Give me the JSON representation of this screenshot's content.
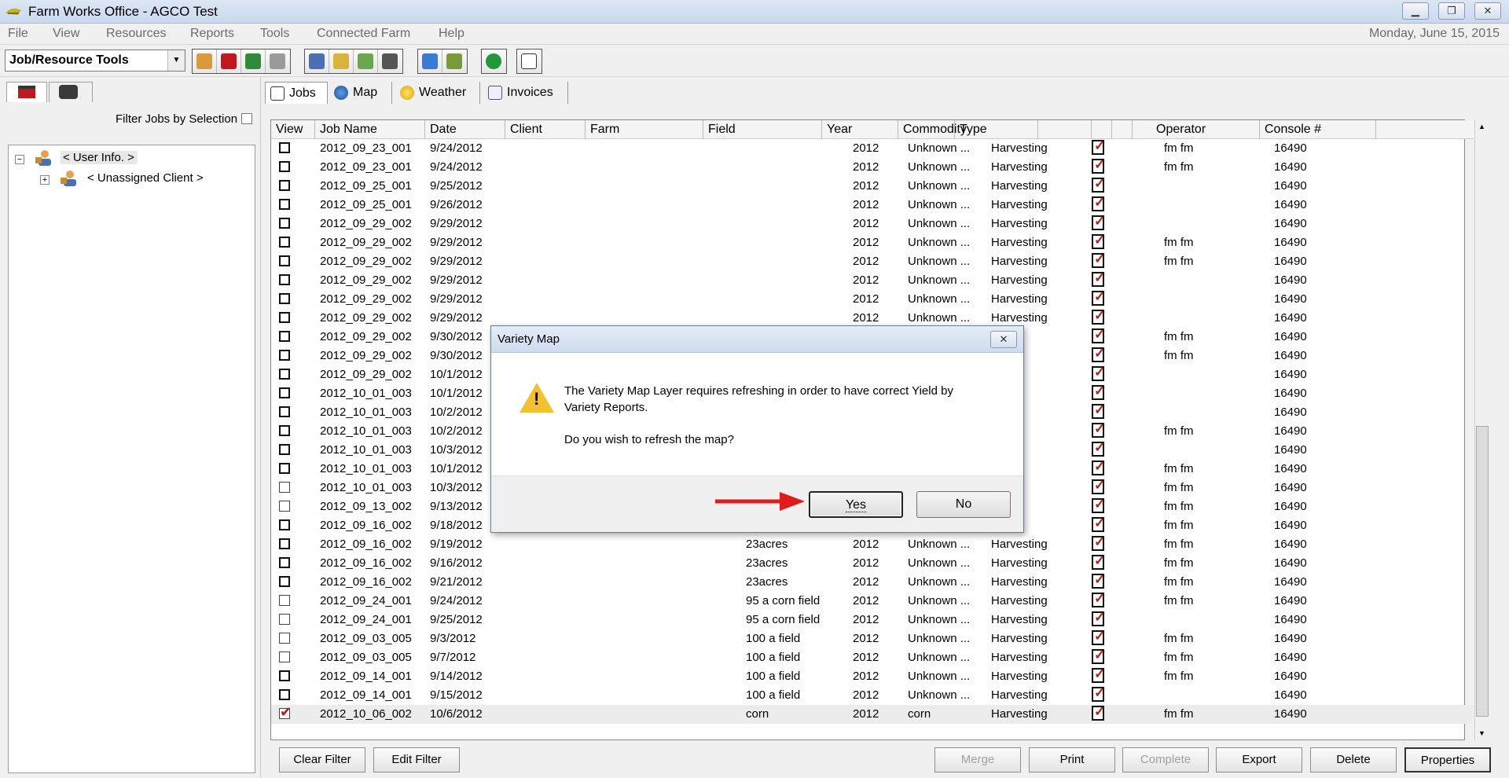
{
  "window": {
    "title": "Farm Works Office - AGCO Test"
  },
  "menu": {
    "items": [
      "File",
      "View",
      "Resources",
      "Reports",
      "Tools",
      "Connected Farm",
      "Help"
    ],
    "date": "Monday, June 15, 2015"
  },
  "toolbar": {
    "combo_value": "Job/Resource Tools"
  },
  "left": {
    "filter_label": "Filter Jobs by Selection",
    "tree_root": "< User Info. >",
    "tree_child": "< Unassigned Client >"
  },
  "tabs": [
    {
      "label": "Jobs",
      "icon": "clipboard-icon"
    },
    {
      "label": "Map",
      "icon": "globe-icon"
    },
    {
      "label": "Weather",
      "icon": "weather-icon"
    },
    {
      "label": "Invoices",
      "icon": "invoice-icon"
    }
  ],
  "grid": {
    "columns": [
      "View",
      "Job Name",
      "Date",
      "Client",
      "Farm",
      "Field",
      "Year",
      "Commodity",
      "Type",
      "",
      "",
      "",
      "Operator",
      "Console #"
    ],
    "rows": [
      {
        "view": "bold",
        "job": "2012_09_23_001",
        "date": "9/24/2012",
        "field": "",
        "year": "2012",
        "commodity": "Unknown ...",
        "type": "Harvesting",
        "operator": "fm fm",
        "console": "16490"
      },
      {
        "view": "bold",
        "job": "2012_09_23_001",
        "date": "9/24/2012",
        "field": "",
        "year": "2012",
        "commodity": "Unknown ...",
        "type": "Harvesting",
        "operator": "fm fm",
        "console": "16490"
      },
      {
        "view": "bold",
        "job": "2012_09_25_001",
        "date": "9/25/2012",
        "field": "",
        "year": "2012",
        "commodity": "Unknown ...",
        "type": "Harvesting",
        "operator": "",
        "console": "16490"
      },
      {
        "view": "bold",
        "job": "2012_09_25_001",
        "date": "9/26/2012",
        "field": "",
        "year": "2012",
        "commodity": "Unknown ...",
        "type": "Harvesting",
        "operator": "",
        "console": "16490"
      },
      {
        "view": "bold",
        "job": "2012_09_29_002",
        "date": "9/29/2012",
        "field": "",
        "year": "2012",
        "commodity": "Unknown ...",
        "type": "Harvesting",
        "operator": "",
        "console": "16490"
      },
      {
        "view": "bold",
        "job": "2012_09_29_002",
        "date": "9/29/2012",
        "field": "",
        "year": "2012",
        "commodity": "Unknown ...",
        "type": "Harvesting",
        "operator": "fm fm",
        "console": "16490"
      },
      {
        "view": "bold",
        "job": "2012_09_29_002",
        "date": "9/29/2012",
        "field": "",
        "year": "2012",
        "commodity": "Unknown ...",
        "type": "Harvesting",
        "operator": "fm fm",
        "console": "16490"
      },
      {
        "view": "bold",
        "job": "2012_09_29_002",
        "date": "9/29/2012",
        "field": "",
        "year": "2012",
        "commodity": "Unknown ...",
        "type": "Harvesting",
        "operator": "",
        "console": "16490"
      },
      {
        "view": "bold",
        "job": "2012_09_29_002",
        "date": "9/29/2012",
        "field": "",
        "year": "2012",
        "commodity": "Unknown ...",
        "type": "Harvesting",
        "operator": "",
        "console": "16490"
      },
      {
        "view": "bold",
        "job": "2012_09_29_002",
        "date": "9/29/2012",
        "field": "",
        "year": "2012",
        "commodity": "Unknown ...",
        "type": "Harvesting",
        "operator": "",
        "console": "16490"
      },
      {
        "view": "bold",
        "job": "2012_09_29_002",
        "date": "9/30/2012",
        "field": "",
        "year": "",
        "commodity": "",
        "type": "ting",
        "operator": "fm fm",
        "console": "16490"
      },
      {
        "view": "bold",
        "job": "2012_09_29_002",
        "date": "9/30/2012",
        "field": "",
        "year": "",
        "commodity": "",
        "type": "ting",
        "operator": "fm fm",
        "console": "16490"
      },
      {
        "view": "bold",
        "job": "2012_09_29_002",
        "date": "10/1/2012",
        "field": "",
        "year": "",
        "commodity": "",
        "type": "ting",
        "operator": "",
        "console": "16490"
      },
      {
        "view": "bold",
        "job": "2012_10_01_003",
        "date": "10/1/2012",
        "field": "",
        "year": "",
        "commodity": "",
        "type": "ting",
        "operator": "",
        "console": "16490"
      },
      {
        "view": "bold",
        "job": "2012_10_01_003",
        "date": "10/2/2012",
        "field": "",
        "year": "",
        "commodity": "",
        "type": "ting",
        "operator": "",
        "console": "16490"
      },
      {
        "view": "bold",
        "job": "2012_10_01_003",
        "date": "10/2/2012",
        "field": "",
        "year": "",
        "commodity": "",
        "type": "ting",
        "operator": "fm fm",
        "console": "16490"
      },
      {
        "view": "bold",
        "job": "2012_10_01_003",
        "date": "10/3/2012",
        "field": "",
        "year": "",
        "commodity": "",
        "type": "ting",
        "operator": "",
        "console": "16490"
      },
      {
        "view": "bold",
        "job": "2012_10_01_003",
        "date": "10/1/2012",
        "field": "",
        "year": "",
        "commodity": "",
        "type": "ting",
        "operator": "fm fm",
        "console": "16490"
      },
      {
        "view": "thin",
        "job": "2012_10_01_003",
        "date": "10/3/2012",
        "field": "",
        "year": "",
        "commodity": "",
        "type": "ting",
        "operator": "fm fm",
        "console": "16490"
      },
      {
        "view": "thin",
        "job": "2012_09_13_002",
        "date": "9/13/2012",
        "field": "",
        "year": "",
        "commodity": "",
        "type": "ting",
        "operator": "fm fm",
        "console": "16490"
      },
      {
        "view": "bold",
        "job": "2012_09_16_002",
        "date": "9/18/2012",
        "field": "",
        "year": "",
        "commodity": "",
        "type": "ting",
        "operator": "fm fm",
        "console": "16490"
      },
      {
        "view": "bold",
        "job": "2012_09_16_002",
        "date": "9/19/2012",
        "field": "23acres",
        "year": "2012",
        "commodity": "Unknown ...",
        "type": "Harvesting",
        "operator": "fm fm",
        "console": "16490"
      },
      {
        "view": "bold",
        "job": "2012_09_16_002",
        "date": "9/16/2012",
        "field": "23acres",
        "year": "2012",
        "commodity": "Unknown ...",
        "type": "Harvesting",
        "operator": "fm fm",
        "console": "16490"
      },
      {
        "view": "bold",
        "job": "2012_09_16_002",
        "date": "9/21/2012",
        "field": "23acres",
        "year": "2012",
        "commodity": "Unknown ...",
        "type": "Harvesting",
        "operator": "fm fm",
        "console": "16490"
      },
      {
        "view": "thin",
        "job": "2012_09_24_001",
        "date": "9/24/2012",
        "field": "95 a corn field",
        "year": "2012",
        "commodity": "Unknown ...",
        "type": "Harvesting",
        "operator": "fm fm",
        "console": "16490"
      },
      {
        "view": "thin",
        "job": "2012_09_24_001",
        "date": "9/25/2012",
        "field": "95 a corn field",
        "year": "2012",
        "commodity": "Unknown ...",
        "type": "Harvesting",
        "operator": "",
        "console": "16490"
      },
      {
        "view": "thin",
        "job": "2012_09_03_005",
        "date": "9/3/2012",
        "field": "100 a field",
        "year": "2012",
        "commodity": "Unknown ...",
        "type": "Harvesting",
        "operator": "fm fm",
        "console": "16490"
      },
      {
        "view": "thin",
        "job": "2012_09_03_005",
        "date": "9/7/2012",
        "field": "100 a field",
        "year": "2012",
        "commodity": "Unknown ...",
        "type": "Harvesting",
        "operator": "fm fm",
        "console": "16490"
      },
      {
        "view": "bold",
        "job": "2012_09_14_001",
        "date": "9/14/2012",
        "field": "100 a field",
        "year": "2012",
        "commodity": "Unknown ...",
        "type": "Harvesting",
        "operator": "fm fm",
        "console": "16490"
      },
      {
        "view": "bold",
        "job": "2012_09_14_001",
        "date": "9/15/2012",
        "field": "100 a field",
        "year": "2012",
        "commodity": "Unknown ...",
        "type": "Harvesting",
        "operator": "",
        "console": "16490"
      },
      {
        "view": "checked",
        "job": "2012_10_06_002",
        "date": "10/6/2012",
        "field": "corn",
        "year": "2012",
        "commodity": "corn",
        "type": "Harvesting",
        "operator": "fm fm",
        "console": "16490"
      }
    ]
  },
  "buttons": {
    "clear_filter": "Clear Filter",
    "edit_filter": "Edit Filter",
    "merge": "Merge",
    "print": "Print",
    "complete": "Complete",
    "export": "Export",
    "delete": "Delete",
    "properties": "Properties"
  },
  "dialog": {
    "title": "Variety Map",
    "message": "The Variety Map Layer requires refreshing in order to have correct Yield by Variety Reports.",
    "question": "Do you wish to refresh the map?",
    "yes": "Yes",
    "no": "No"
  },
  "colors": {
    "accent_red": "#c0181f",
    "arrow_red": "#e01b1b",
    "warning_yellow": "#f2c12e"
  }
}
